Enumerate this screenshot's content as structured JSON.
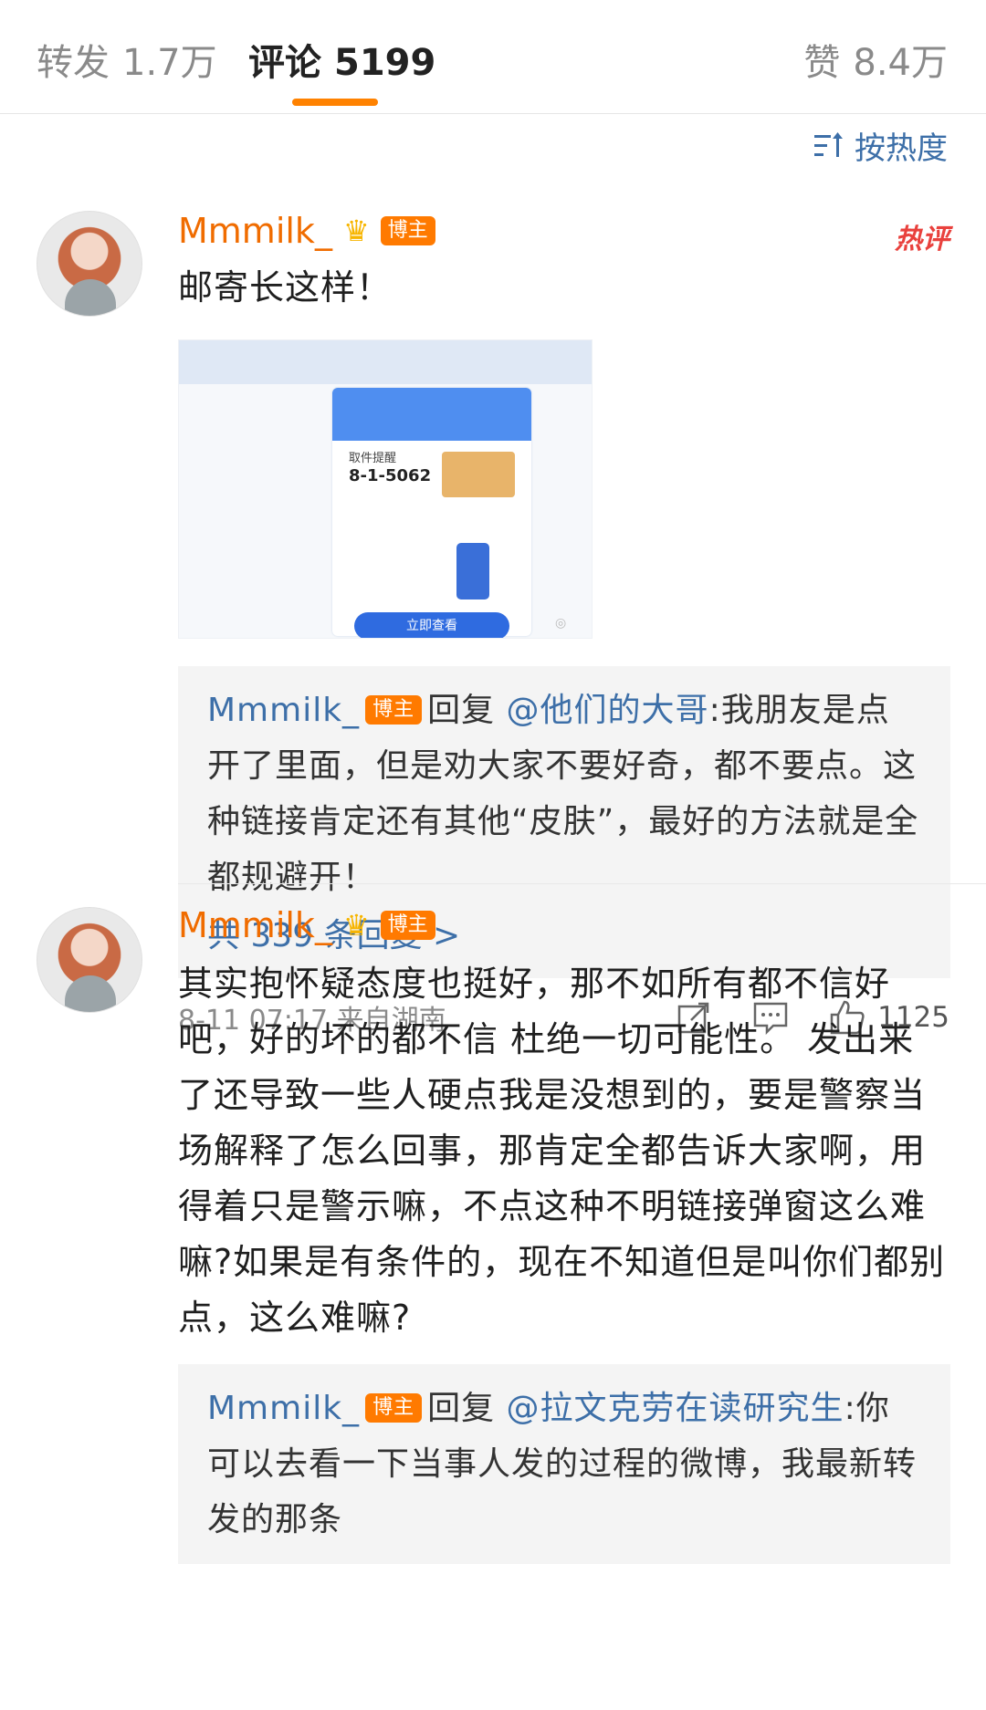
{
  "tabs": {
    "repost": {
      "label": "转发",
      "count": "1.7万"
    },
    "comment": {
      "label": "评论",
      "count": "5199"
    },
    "like": {
      "label": "赞",
      "count": "8.4万"
    }
  },
  "sort": {
    "label": "按热度",
    "icon": "sort-lines-icon"
  },
  "comments": [
    {
      "username": "Mmmilk_",
      "badge": "博主",
      "hot_label": "热评",
      "text": "邮寄长这样！",
      "image": {
        "pickup_label": "取件提醒",
        "pickup_code": "8-1-5062",
        "button": "立即查看"
      },
      "reply": {
        "username": "Mmmilk_",
        "badge": "博主",
        "verb": "回复",
        "target": "@他们的大哥",
        "text": ":我朋友是点开了里面，但是劝大家不要好奇，都不要点。这种链接肯定还有其他“皮肤”，最好的方法就是全都规避开！",
        "count_label": "共 339 条回复 >"
      },
      "meta": "8-11 07:17  来自湖南",
      "like_count": "1125"
    },
    {
      "username": "Mmmilk_",
      "badge": "博主",
      "text": "其实抱怀疑态度也挺好，那不如所有都不信好吧，好的坏的都不信  杜绝一切可能性。 发出来了还导致一些人硬点我是没想到的，要是警察当场解释了怎么回事，那肯定全都告诉大家啊，用得着只是警示嘛，不点这种不明链接弹窗这么难嘛?如果是有条件的，现在不知道但是叫你们都别点，这么难嘛?",
      "reply": {
        "username": "Mmmilk_",
        "badge": "博主",
        "verb": "回复",
        "target": "@拉文克劳在读研究生",
        "text": ":你可以去看一下当事人发的过程的微博，我最新转发的那条"
      }
    }
  ],
  "colors": {
    "accent": "#ff8200",
    "link": "#3d6fa8",
    "username": "#f06c00",
    "badge": "#ff7a00",
    "hot": "#e9413d"
  }
}
